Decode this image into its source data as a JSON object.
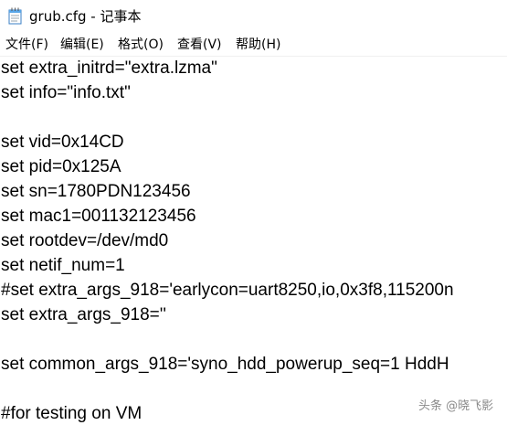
{
  "window": {
    "title": "grub.cfg - 记事本"
  },
  "menubar": {
    "items": [
      {
        "label": "文件(F)"
      },
      {
        "label": "编辑(E)"
      },
      {
        "label": "格式(O)"
      },
      {
        "label": "查看(V)"
      },
      {
        "label": "帮助(H)"
      }
    ]
  },
  "editor": {
    "lines": [
      "set extra_initrd=\"extra.lzma\"",
      "set info=\"info.txt\"",
      "",
      "set vid=0x14CD",
      "set pid=0x125A",
      "set sn=1780PDN123456",
      "set mac1=001132123456",
      "set rootdev=/dev/md0",
      "set netif_num=1",
      "#set extra_args_918='earlycon=uart8250,io,0x3f8,115200n",
      "set extra_args_918=''",
      "",
      "set common_args_918='syno_hdd_powerup_seq=1 HddH",
      "",
      "#for testing on VM"
    ]
  },
  "watermark": {
    "text": "头条 @晓飞影"
  },
  "icons": {
    "app": "notepad-icon"
  }
}
